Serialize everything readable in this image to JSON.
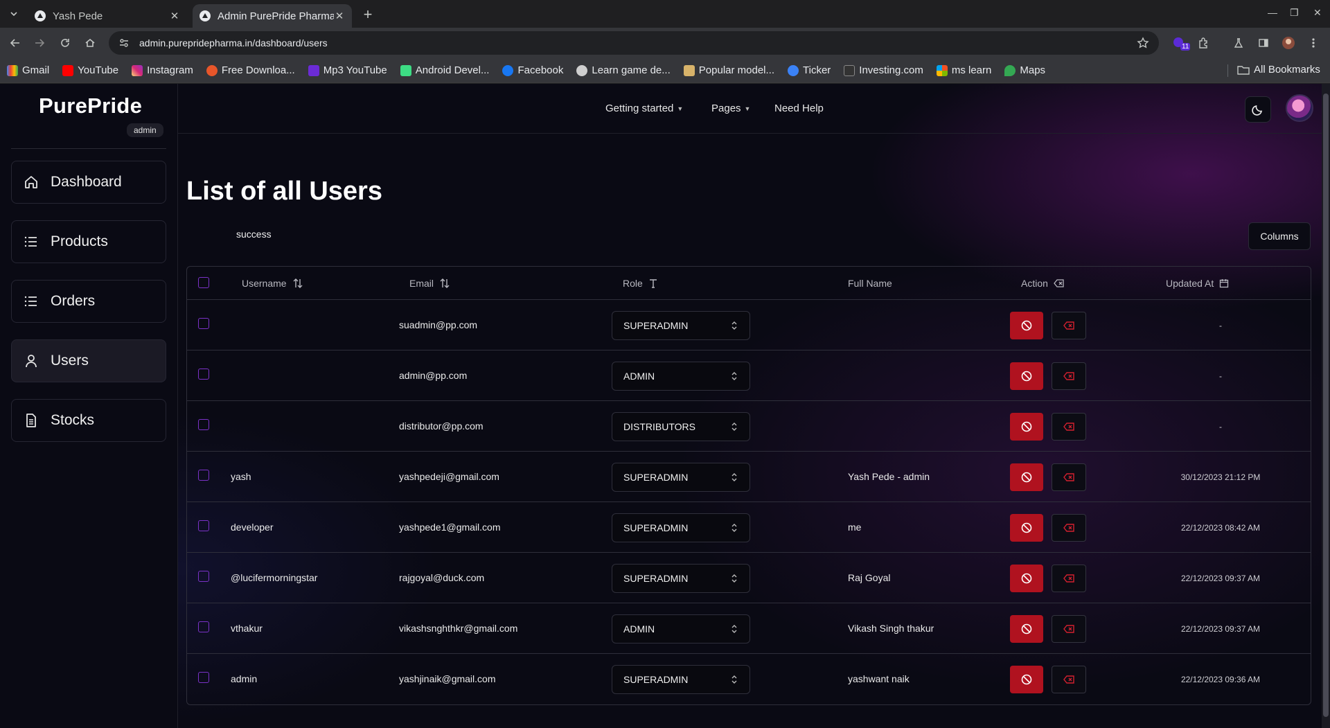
{
  "browser": {
    "tabs": [
      {
        "title": "Yash Pede",
        "active": false
      },
      {
        "title": "Admin PurePride Pharma",
        "active": true
      }
    ],
    "url": "admin.purepridepharma.in/dashboard/users",
    "bookmarks": [
      "Gmail",
      "YouTube",
      "Instagram",
      "Free Downloa...",
      "Mp3 YouTube",
      "Android Devel...",
      "Facebook",
      "Learn game de...",
      "Popular model...",
      "Ticker",
      "Investing.com",
      "ms learn",
      "Maps"
    ],
    "all_bookmarks": "All Bookmarks",
    "extension_badge": "11"
  },
  "sidebar": {
    "brand": "PurePride",
    "badge": "admin",
    "items": [
      {
        "label": "Dashboard",
        "icon": "home-icon"
      },
      {
        "label": "Products",
        "icon": "list-icon"
      },
      {
        "label": "Orders",
        "icon": "list-icon"
      },
      {
        "label": "Users",
        "icon": "user-icon",
        "active": true
      },
      {
        "label": "Stocks",
        "icon": "document-icon"
      }
    ]
  },
  "topnav": {
    "getting_started": "Getting started",
    "pages": "Pages",
    "need_help": "Need Help"
  },
  "main": {
    "title": "List of all Users",
    "status": "success",
    "columns_button": "Columns",
    "table": {
      "headers": {
        "username": "Username",
        "email": "Email",
        "role": "Role",
        "full_name": "Full Name",
        "action": "Action",
        "updated_at": "Updated At"
      },
      "rows": [
        {
          "username": "",
          "email": "suadmin@pp.com",
          "role": "SUPERADMIN",
          "full_name": "",
          "updated_at": "-"
        },
        {
          "username": "",
          "email": "admin@pp.com",
          "role": "ADMIN",
          "full_name": "",
          "updated_at": "-"
        },
        {
          "username": "",
          "email": "distributor@pp.com",
          "role": "DISTRIBUTORS",
          "full_name": "",
          "updated_at": "-"
        },
        {
          "username": "yash",
          "email": "yashpedeji@gmail.com",
          "role": "SUPERADMIN",
          "full_name": "Yash Pede - admin",
          "updated_at": "30/12/2023 21:12 PM"
        },
        {
          "username": "developer",
          "email": "yashpede1@gmail.com",
          "role": "SUPERADMIN",
          "full_name": "me",
          "updated_at": "22/12/2023 08:42 AM"
        },
        {
          "username": "@lucifermorningstar",
          "email": "rajgoyal@duck.com",
          "role": "SUPERADMIN",
          "full_name": "Raj Goyal",
          "updated_at": "22/12/2023 09:37 AM"
        },
        {
          "username": "vthakur",
          "email": "vikashsnghthkr@gmail.com",
          "role": "ADMIN",
          "full_name": "Vikash Singh thakur",
          "updated_at": "22/12/2023 09:37 AM"
        },
        {
          "username": "admin",
          "email": "yashjinaik@gmail.com",
          "role": "SUPERADMIN",
          "full_name": "yashwant naik",
          "updated_at": "22/12/2023 09:36 AM"
        }
      ]
    }
  },
  "colors": {
    "accent": "#b0121f",
    "checkbox": "#7b32c8",
    "background": "#0a0a14"
  }
}
